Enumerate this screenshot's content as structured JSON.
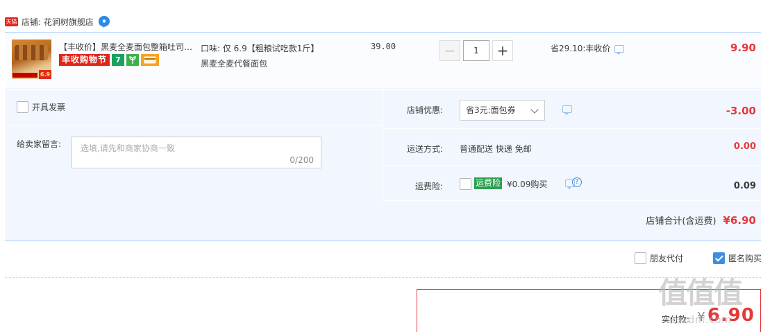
{
  "shop": {
    "badge": "天猫",
    "label": "店铺: 花涧树旗舰店"
  },
  "item": {
    "title": "【丰收价】黑麦全麦面包整箱吐司早餐健身代餐",
    "image_tag": "6.9",
    "promo_banner": "丰收购物节",
    "promo_seven": "7",
    "sku_line1": "口味: 仅 6.9【粗粮试吃款1斤】",
    "sku_line2": "黑麦全麦代餐面包",
    "unit_price": "39.00",
    "quantity": "1",
    "minus": "−",
    "plus": "+",
    "savings": "省29.10:丰收价",
    "subtotal": "9.90"
  },
  "invoice": {
    "label": "开具发票"
  },
  "memo": {
    "label": "给卖家留言:",
    "placeholder": "选填,请先和商家协商一致",
    "counter": "0/200"
  },
  "discount": {
    "label": "店铺优惠:",
    "selected": "省3元:面包券",
    "value": "-3.00"
  },
  "shipping": {
    "label": "运送方式:",
    "text": "普通配送 快递 免邮",
    "value": "0.00"
  },
  "insurance": {
    "label": "运费险:",
    "badge": "运费险",
    "price": "¥0.09购买",
    "help": "?",
    "value": "0.09"
  },
  "shop_total": {
    "label": "店铺合计(含运费)",
    "value": "¥6.90"
  },
  "options": {
    "friend_pay": "朋友代付",
    "anonymous": "匿名购买"
  },
  "payment": {
    "label": "实付款:",
    "yen": "¥",
    "amount": "6.90"
  },
  "watermark": {
    "text": "值值值",
    "site": "smzdm.com"
  },
  "colors": {
    "price_red": "#e4393c",
    "panel_bg": "#f2f7ff",
    "accent_blue": "#3d8fe0",
    "tmall_red": "#e1251b"
  }
}
